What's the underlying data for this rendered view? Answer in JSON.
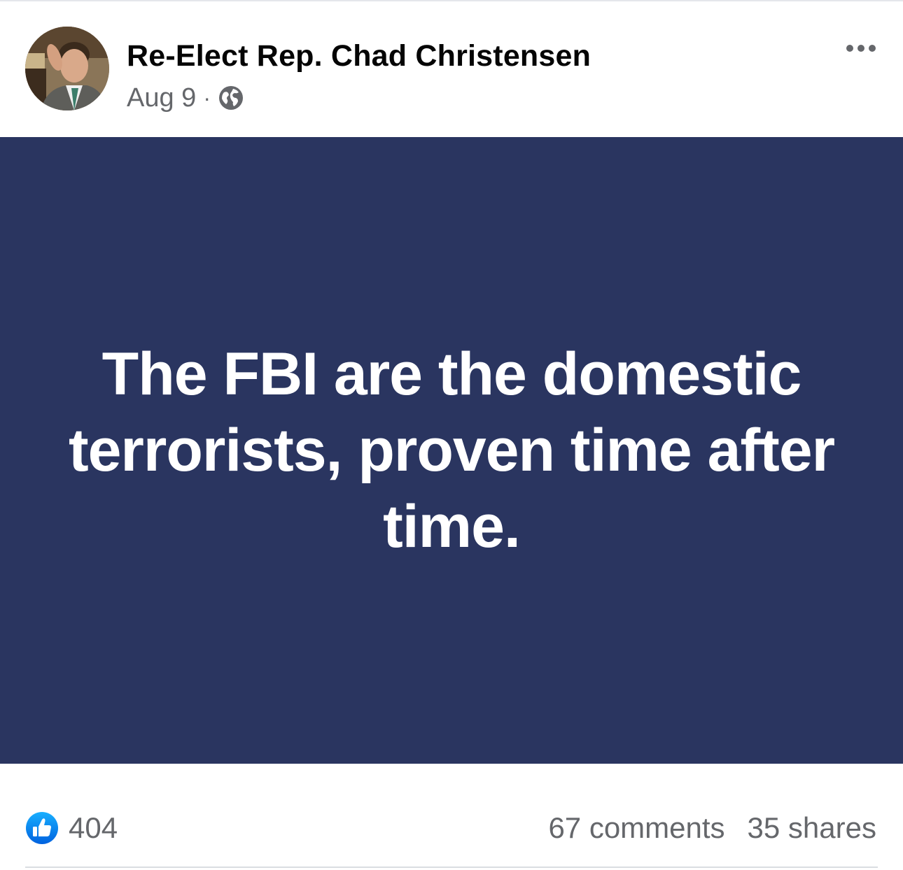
{
  "post": {
    "author": "Re-Elect Rep. Chad Christensen",
    "date": "Aug 9",
    "separator": "·",
    "privacy_icon": "globe-icon",
    "more_icon": "more-options-icon",
    "text": "The FBI are the domestic terrorists, proven time after time.",
    "background_color": "#2a3560",
    "text_color": "#ffffff"
  },
  "engagement": {
    "reaction_icon": "like-icon",
    "reaction_count": "404",
    "comments": "67 comments",
    "shares": "35 shares"
  },
  "colors": {
    "secondary_text": "#65676b",
    "like_blue": "#1b74e4"
  }
}
